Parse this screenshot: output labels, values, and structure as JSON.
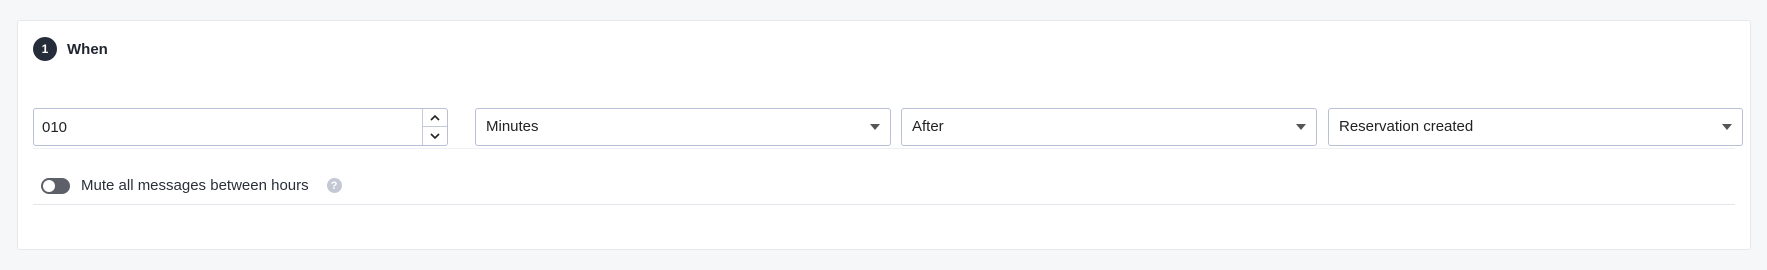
{
  "section": {
    "step_number": "1",
    "title": "When"
  },
  "delay": {
    "value": "010",
    "stepper_up_icon": "chevron-up-icon",
    "stepper_down_icon": "chevron-down-icon"
  },
  "unit_select": {
    "selected": "Minutes"
  },
  "direction_select": {
    "selected": "After"
  },
  "event_select": {
    "selected": "Reservation created"
  },
  "mute": {
    "label": "Mute all messages between hours",
    "enabled": false,
    "help_icon": "question-mark-icon",
    "help_glyph": "?"
  },
  "colors": {
    "badge": "#262d3a",
    "field_border": "#b9bfd6",
    "toggle_off": "#5d6068",
    "help_icon": "#c4c8d4",
    "page_background": "#f6f7f9"
  }
}
